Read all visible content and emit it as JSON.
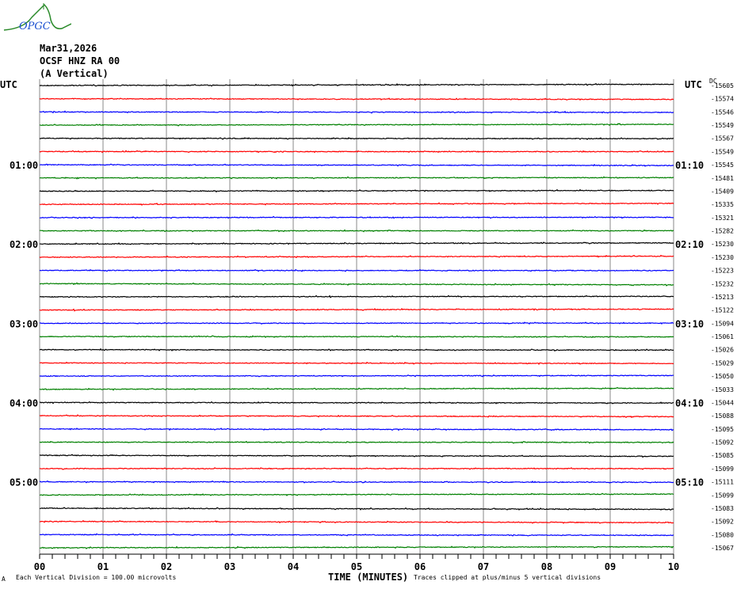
{
  "logo": {
    "text": "OPGC"
  },
  "header": {
    "date": "Mar31,2026",
    "station": "OCSF HNZ RA 00",
    "component": "(A Vertical)"
  },
  "utc_label": "UTC",
  "dc_label": "DC",
  "footer": {
    "scale": "Each Vertical Division =  100.00 microvolts",
    "xlabel": "TIME (MINUTES)",
    "clip_note": "Traces clipped at plus/minus 5 vertical divisions",
    "corner": "A"
  },
  "chart_data": {
    "type": "line",
    "title": "OCSF HNZ RA 00 helicorder",
    "xlabel": "TIME (MINUTES)",
    "xlim": [
      0,
      10
    ],
    "x_ticks": [
      "00",
      "01",
      "02",
      "03",
      "04",
      "05",
      "06",
      "07",
      "08",
      "09",
      "10"
    ],
    "trace_colors": [
      "#000000",
      "#ff0000",
      "#0000ff",
      "#008000"
    ],
    "left_time_labels": [
      {
        "row": 6,
        "text": "01:00"
      },
      {
        "row": 12,
        "text": "02:00"
      },
      {
        "row": 18,
        "text": "03:00"
      },
      {
        "row": 24,
        "text": "04:00"
      },
      {
        "row": 30,
        "text": "05:00"
      }
    ],
    "right_time_labels": [
      {
        "row": 6,
        "text": "01:10"
      },
      {
        "row": 12,
        "text": "02:10"
      },
      {
        "row": 18,
        "text": "03:10"
      },
      {
        "row": 24,
        "text": "04:10"
      },
      {
        "row": 30,
        "text": "05:10"
      }
    ],
    "dc_offsets": [
      -15605,
      -15574,
      -15546,
      -15549,
      -15567,
      -15549,
      -15545,
      -15481,
      -15409,
      -15335,
      -15321,
      -15282,
      -15230,
      -15230,
      -15223,
      -15232,
      -15213,
      -15122,
      -15094,
      -15061,
      -15026,
      -15029,
      -15050,
      -15033,
      -15044,
      -15088,
      -15095,
      -15092,
      -15085,
      -15099,
      -15111,
      -15099,
      -15083,
      -15092,
      -15080,
      -15067
    ]
  }
}
